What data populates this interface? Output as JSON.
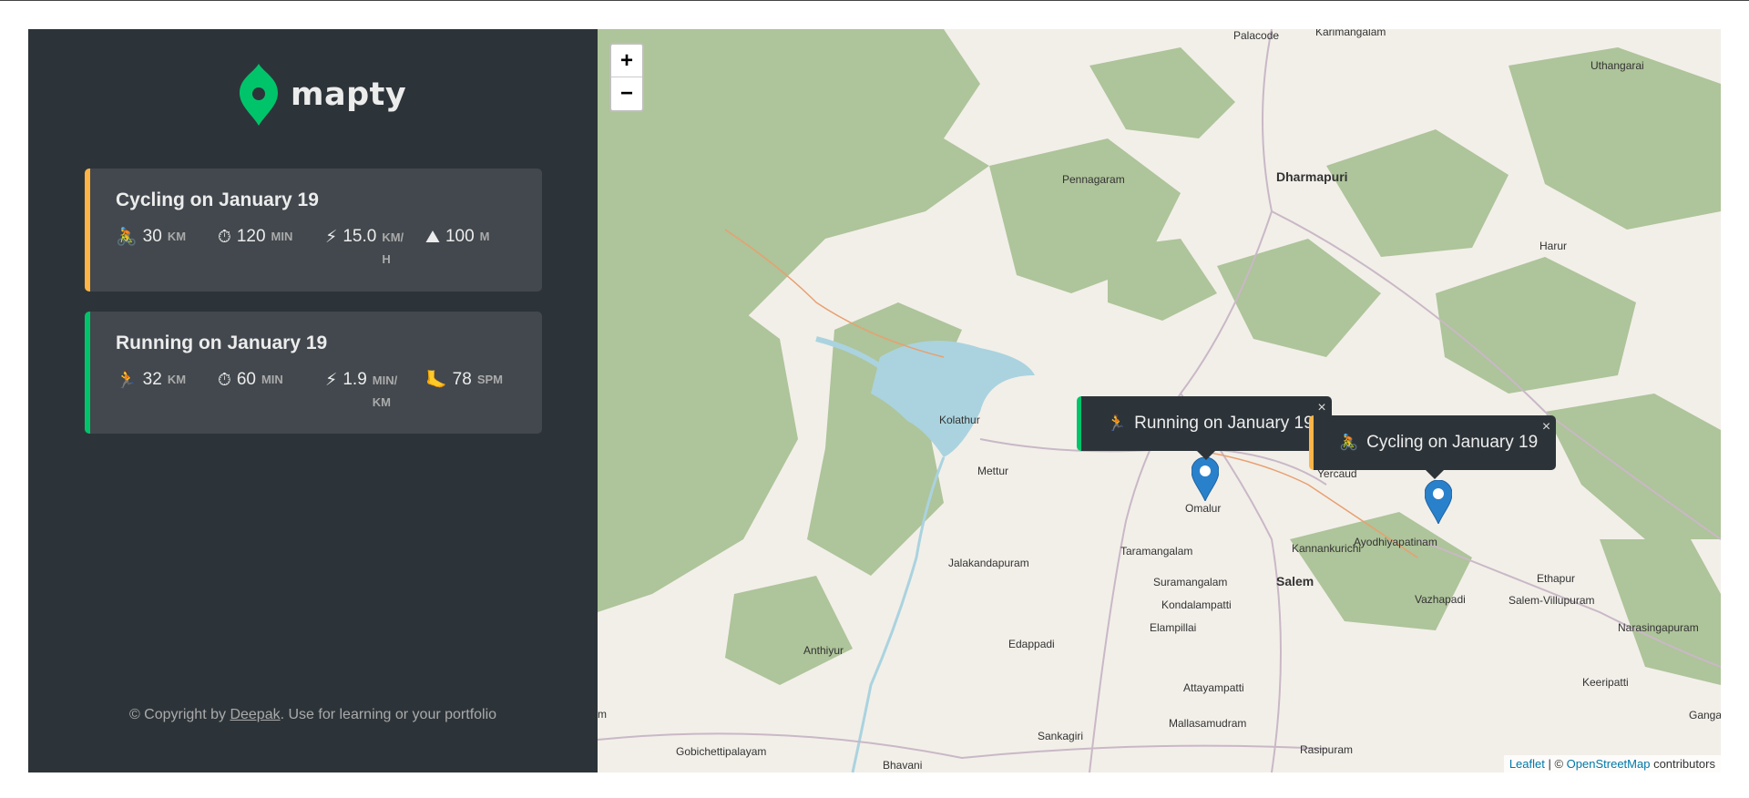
{
  "brand": {
    "name": "mapty"
  },
  "colors": {
    "cycling": "#ffb545",
    "running": "#00c46a",
    "sidebar": "#2d3439",
    "card": "#42484d"
  },
  "workouts": [
    {
      "type": "cycling",
      "title": "Cycling on January 19",
      "icon": "🚴",
      "distance": "30",
      "distance_unit": "KM",
      "duration": "120",
      "duration_unit": "MIN",
      "speed": "15.0",
      "speed_unit": "KM/H",
      "extra_icon": "⛰",
      "extra": "100",
      "extra_unit": "M"
    },
    {
      "type": "running",
      "title": "Running on January 19",
      "icon": "🏃",
      "distance": "32",
      "distance_unit": "KM",
      "duration": "60",
      "duration_unit": "MIN",
      "speed": "1.9",
      "speed_unit": "MIN/KM",
      "extra_icon": "🦶",
      "extra": "78",
      "extra_unit": "SPM"
    }
  ],
  "icons": {
    "duration": "⏱",
    "speed": "⚡"
  },
  "footer": {
    "prefix": "© Copyright by ",
    "author": "Deepak",
    "suffix": ". Use for learning or your portfolio"
  },
  "map": {
    "zoom_in": "+",
    "zoom_out": "−",
    "popups": [
      {
        "icon": "🏃",
        "text": "Running on January 19",
        "close": "×"
      },
      {
        "icon": "🚴",
        "text": "Cycling on January 19",
        "close": "×"
      }
    ],
    "attribution": {
      "leaflet": "Leaflet",
      "sep": " | © ",
      "osm": "OpenStreetMap",
      "suffix": " contributors"
    },
    "places": [
      "Palacode",
      "Karimangalam",
      "Uthangarai",
      "Pennagaram",
      "Dharmapuri",
      "Harur",
      "Kolathur",
      "Mettur",
      "Yercaud",
      "Omalur",
      "Taramangalam",
      "Kannankurichi",
      "Ayodhiyapatinam",
      "Ethapur",
      "Suramangalam",
      "Salem",
      "Vazhapadi",
      "Salem-Villupuram",
      "Narasingapuram",
      "Jalakandapuram",
      "Kondalampatti",
      "Elampillai",
      "Edappadi",
      "Anthiyur",
      "Keeripatti",
      "Attayampatti",
      "Gangav",
      "Mallasamudram",
      "Sankagiri",
      "Rasipuram",
      "Gobichettipalayam",
      "Bhavani",
      "m"
    ]
  }
}
